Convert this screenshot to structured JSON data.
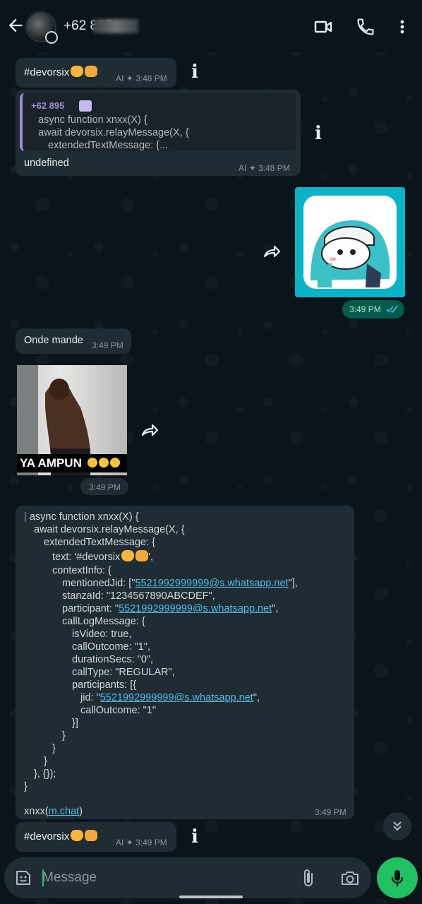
{
  "header": {
    "contact_name": "+62 895",
    "icons": [
      "back-arrow-icon",
      "video-call-icon",
      "voice-call-icon",
      "more-options-icon"
    ]
  },
  "messages": [
    {
      "id": "m1",
      "direction": "in",
      "text": "#devorsix",
      "time": "3:48 PM",
      "ai_label": "AI"
    },
    {
      "id": "m2",
      "direction": "in",
      "quote": {
        "author": "+62 895",
        "lines": [
          "async function xnxx(X) {",
          "await devorsix.relayMessage(X, {",
          "extendedTextMessage: {..."
        ]
      },
      "text": "undefined",
      "time": "3:48 PM",
      "ai_label": "AI"
    },
    {
      "id": "m3",
      "direction": "out",
      "type": "sticker",
      "time": "3:49 PM"
    },
    {
      "id": "m4",
      "direction": "in",
      "text": "Onde mande",
      "time": "3:49 PM"
    },
    {
      "id": "m5",
      "direction": "in",
      "type": "image",
      "caption": "YA AMPUN",
      "time": "3:49 PM"
    },
    {
      "id": "m6",
      "direction": "in",
      "type": "code",
      "lines": [
        "async function xnxx(X) {",
        "await devorsix.relayMessage(X, {",
        "extendedTextMessage: {",
        "text: '#devorsix",
        "contextInfo: {",
        "mentionedJid: [\"",
        "5521992999999@s.whatsapp.net",
        "\"],",
        "stanzaId: \"1234567890ABCDEF\",",
        "participant: \"",
        "5521992999999@s.whatsapp.net",
        "\",",
        "callLogMessage: {",
        "isVideo: true,",
        "callOutcome: \"1\",",
        "durationSecs: \"0\",",
        "callType: \"REGULAR\",",
        "participants: [{",
        "jid: \"",
        "5521992999999@s.whatsapp.net",
        "\",",
        "callOutcome: \"1\"",
        "}]",
        "}",
        "}",
        "}",
        "}, {});",
        "}",
        "xnxx(",
        "m.chat",
        ")"
      ],
      "time": "3:49 PM"
    },
    {
      "id": "m7",
      "direction": "in",
      "text": "#devorsix",
      "time": "3:49 PM",
      "ai_label": "AI"
    }
  ],
  "input": {
    "placeholder": "Message"
  },
  "colors": {
    "background": "#0b141a",
    "incoming_bubble": "#1f2c33",
    "outgoing_bubble": "#005c4b",
    "link": "#53bdeb",
    "mic_button": "#21c063",
    "read_ticks": "#53bdeb"
  }
}
